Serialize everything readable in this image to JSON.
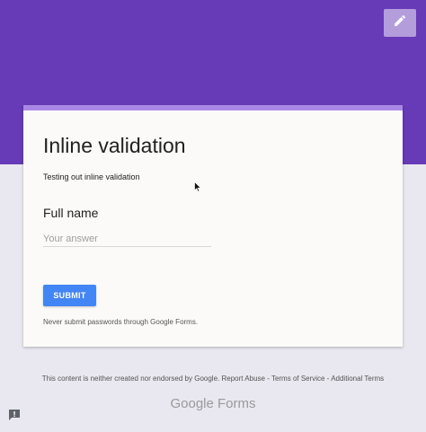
{
  "colors": {
    "header": "#673ab7",
    "accent_bar": "#a987e6",
    "submit": "#4285f4",
    "edit_button": "#b39ddb"
  },
  "toolbar": {
    "edit_icon": "pencil-icon"
  },
  "form": {
    "title": "Inline validation",
    "description": "Testing out inline validation",
    "question": {
      "label": "Full name",
      "placeholder": "Your answer",
      "value": ""
    },
    "submit_label": "SUBMIT",
    "password_warning": "Never submit passwords through Google Forms."
  },
  "footer": {
    "disclaimer": "This content is neither created nor endorsed by Google.",
    "links": [
      "Report Abuse",
      "Terms of Service",
      "Additional Terms"
    ],
    "separator": " - ",
    "brand_google": "Google",
    "brand_forms": "Forms"
  },
  "feedback_icon": "report-issue-icon"
}
